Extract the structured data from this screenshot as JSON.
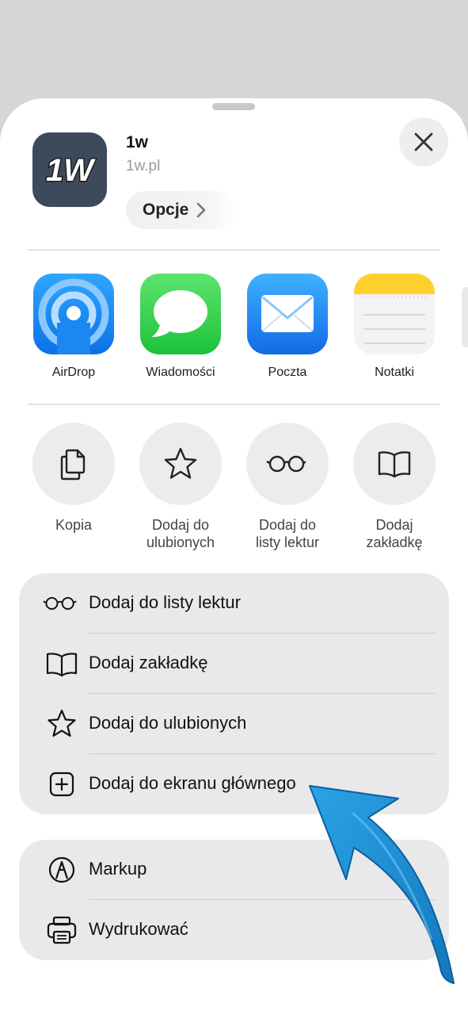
{
  "header": {
    "app_name": "1w",
    "app_url": "1w.pl",
    "logo_text": "1W",
    "options_label": "Opcje"
  },
  "share_apps": [
    {
      "label": "AirDrop",
      "icon": "airdrop-icon"
    },
    {
      "label": "Wiadomości",
      "icon": "messages-icon"
    },
    {
      "label": "Poczta",
      "icon": "mail-icon"
    },
    {
      "label": "Notatki",
      "icon": "notes-icon"
    }
  ],
  "actions": [
    {
      "line1": "Kopia",
      "line2": "",
      "icon": "copy-icon"
    },
    {
      "line1": "Dodaj do",
      "line2": "ulubionych",
      "icon": "star-icon"
    },
    {
      "line1": "Dodaj do",
      "line2": "listy lektur",
      "icon": "glasses-icon"
    },
    {
      "line1": "Dodaj",
      "line2": "zakładkę",
      "icon": "book-icon"
    }
  ],
  "menu_group_1": [
    {
      "label": "Dodaj do listy lektur",
      "icon": "glasses-icon"
    },
    {
      "label": "Dodaj zakładkę",
      "icon": "book-icon"
    },
    {
      "label": "Dodaj do ulubionych",
      "icon": "star-icon"
    },
    {
      "label": "Dodaj do ekranu głównego",
      "icon": "plus-square-icon"
    }
  ],
  "menu_group_2": [
    {
      "label": "Markup",
      "icon": "markup-icon"
    },
    {
      "label": "Wydrukować",
      "icon": "printer-icon"
    }
  ],
  "colors": {
    "sheet_background": "#ffffff",
    "group_background": "#e9e9eb",
    "annotation_arrow": "#1e8fd0",
    "app_icon_background": "#3d4a5c"
  }
}
